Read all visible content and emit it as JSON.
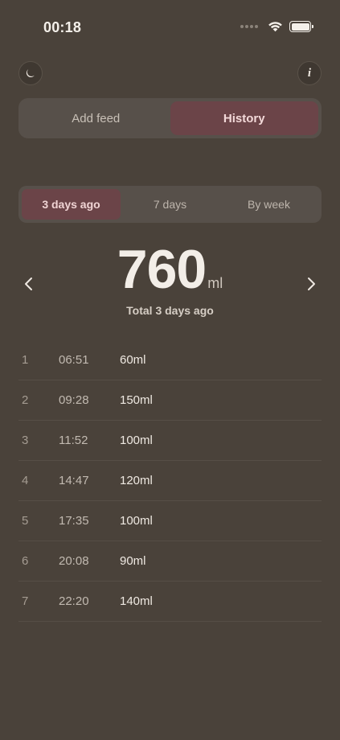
{
  "status": {
    "time": "00:18"
  },
  "header": {
    "moon_icon": "moon-icon",
    "info_label": "i"
  },
  "main_tabs": [
    {
      "label": "Add feed",
      "active": false
    },
    {
      "label": "History",
      "active": true
    }
  ],
  "range_tabs": [
    {
      "label": "3 days ago",
      "active": true
    },
    {
      "label": "7 days",
      "active": false
    },
    {
      "label": "By week",
      "active": false
    }
  ],
  "summary": {
    "total": "760",
    "unit": "ml",
    "caption": "Total 3 days ago"
  },
  "feeds": [
    {
      "num": "1",
      "time": "06:51",
      "amount": "60ml"
    },
    {
      "num": "2",
      "time": "09:28",
      "amount": "150ml"
    },
    {
      "num": "3",
      "time": "11:52",
      "amount": "100ml"
    },
    {
      "num": "4",
      "time": "14:47",
      "amount": "120ml"
    },
    {
      "num": "5",
      "time": "17:35",
      "amount": "100ml"
    },
    {
      "num": "6",
      "time": "20:08",
      "amount": "90ml"
    },
    {
      "num": "7",
      "time": "22:20",
      "amount": "140ml"
    }
  ],
  "colors": {
    "background": "#4a423a",
    "accent": "#6b4448",
    "segment_bg": "#57504a"
  }
}
